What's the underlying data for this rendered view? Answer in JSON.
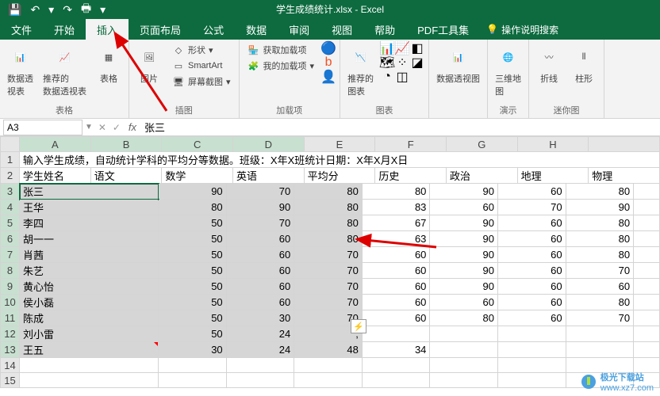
{
  "qat": {
    "save": "💾",
    "undo": "↶",
    "redo": "↷",
    "pb": "🖶"
  },
  "title": "学生成绩统计.xlsx  -  Excel",
  "tabs": [
    "文件",
    "开始",
    "插入",
    "页面布局",
    "公式",
    "数据",
    "审阅",
    "视图",
    "帮助",
    "PDF工具集"
  ],
  "tell_me": "操作说明搜索",
  "ribbon": {
    "g1": {
      "label": "表格",
      "b1": "数据透\n视表",
      "b2": "推荐的\n数据透视表",
      "b3": "表格"
    },
    "g2": {
      "label": "插图",
      "b1": "图片",
      "s1": "形状",
      "s2": "SmartArt",
      "s3": "屏幕截图"
    },
    "g3": {
      "label": "加载项",
      "s1": "获取加载项",
      "s2": "我的加载项"
    },
    "g4": {
      "label": "图表",
      "b1": "推荐的\n图表"
    },
    "g5": {
      "label": "",
      "b1": "数据透视图"
    },
    "g6": {
      "label": "演示",
      "b1": "三维地\n图"
    },
    "g7": {
      "label": "迷你图",
      "b1": "折线",
      "b2": "柱形"
    }
  },
  "namebox": "A3",
  "formula": "张三",
  "cols": [
    "A",
    "B",
    "C",
    "D",
    "E",
    "F",
    "G",
    "H"
  ],
  "r1": "输入学生成绩，自动统计学科的平均分等数据。班级：X年X班统计日期：X年X月X日",
  "hdr": [
    "学生姓名",
    "语文",
    "数学",
    "英语",
    "平均分",
    "历史",
    "政治",
    "地理",
    "物理"
  ],
  "rows": [
    {
      "n": "张三",
      "v": [
        90,
        70,
        80,
        80,
        90,
        60,
        80
      ]
    },
    {
      "n": "王华",
      "v": [
        80,
        90,
        80,
        83,
        60,
        70,
        90
      ]
    },
    {
      "n": "李四",
      "v": [
        50,
        70,
        80,
        67,
        90,
        60,
        80
      ]
    },
    {
      "n": "胡一一",
      "v": [
        50,
        60,
        80,
        63,
        90,
        60,
        80
      ]
    },
    {
      "n": "肖茜",
      "v": [
        50,
        60,
        70,
        60,
        90,
        60,
        80
      ]
    },
    {
      "n": "朱艺",
      "v": [
        50,
        60,
        70,
        60,
        90,
        60,
        70
      ]
    },
    {
      "n": "黄心怡",
      "v": [
        50,
        60,
        70,
        60,
        90,
        60,
        60
      ]
    },
    {
      "n": "侯小磊",
      "v": [
        50,
        60,
        70,
        60,
        60,
        60,
        80
      ]
    },
    {
      "n": "陈成",
      "v": [
        50,
        30,
        70,
        60,
        80,
        60,
        70
      ]
    },
    {
      "n": "刘小雷",
      "v": [
        50,
        24,
        ",",
        "",
        "",
        " ",
        " "
      ]
    },
    {
      "n": "王五",
      "v": [
        30,
        24,
        48,
        34,
        "",
        "",
        ""
      ]
    }
  ],
  "chart_data": {
    "type": "table",
    "title": "学生成绩统计",
    "columns": [
      "学生姓名",
      "语文",
      "数学",
      "英语",
      "平均分",
      "历史",
      "政治",
      "地理"
    ],
    "data": [
      [
        "张三",
        90,
        70,
        80,
        80,
        90,
        60,
        80
      ],
      [
        "王华",
        80,
        90,
        80,
        83,
        60,
        70,
        90
      ],
      [
        "李四",
        50,
        70,
        80,
        67,
        90,
        60,
        80
      ],
      [
        "胡一一",
        50,
        60,
        80,
        63,
        90,
        60,
        80
      ],
      [
        "肖茜",
        50,
        60,
        70,
        60,
        90,
        60,
        80
      ],
      [
        "朱艺",
        50,
        60,
        70,
        60,
        90,
        60,
        70
      ],
      [
        "黄心怡",
        50,
        60,
        70,
        60,
        90,
        60,
        60
      ],
      [
        "侯小磊",
        50,
        60,
        70,
        60,
        60,
        60,
        80
      ],
      [
        "陈成",
        50,
        30,
        70,
        60,
        80,
        60,
        70
      ],
      [
        "王五",
        30,
        24,
        48,
        34,
        null,
        null,
        null
      ]
    ]
  },
  "watermark": {
    "name": "极光下载站",
    "url": "www.xz7.com"
  }
}
